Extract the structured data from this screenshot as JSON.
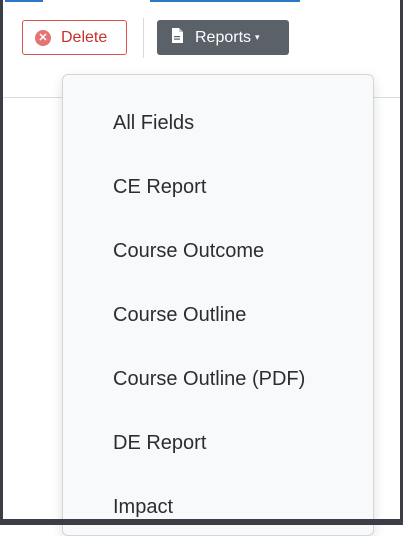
{
  "toolbar": {
    "delete_label": "Delete",
    "delete_icon": "x-circle-icon",
    "reports_label": "Reports",
    "reports_icon": "document-icon",
    "reports_caret": "▾"
  },
  "reports_menu": {
    "items": [
      {
        "label": "All Fields"
      },
      {
        "label": "CE Report"
      },
      {
        "label": "Course Outcome"
      },
      {
        "label": "Course Outline"
      },
      {
        "label": "Course Outline (PDF)"
      },
      {
        "label": "DE Report"
      },
      {
        "label": "Impact"
      }
    ]
  },
  "colors": {
    "danger": "#d9534f",
    "button_dark": "#5a6169",
    "menu_bg": "#f8f9fa",
    "accent": "#2b78c5"
  }
}
